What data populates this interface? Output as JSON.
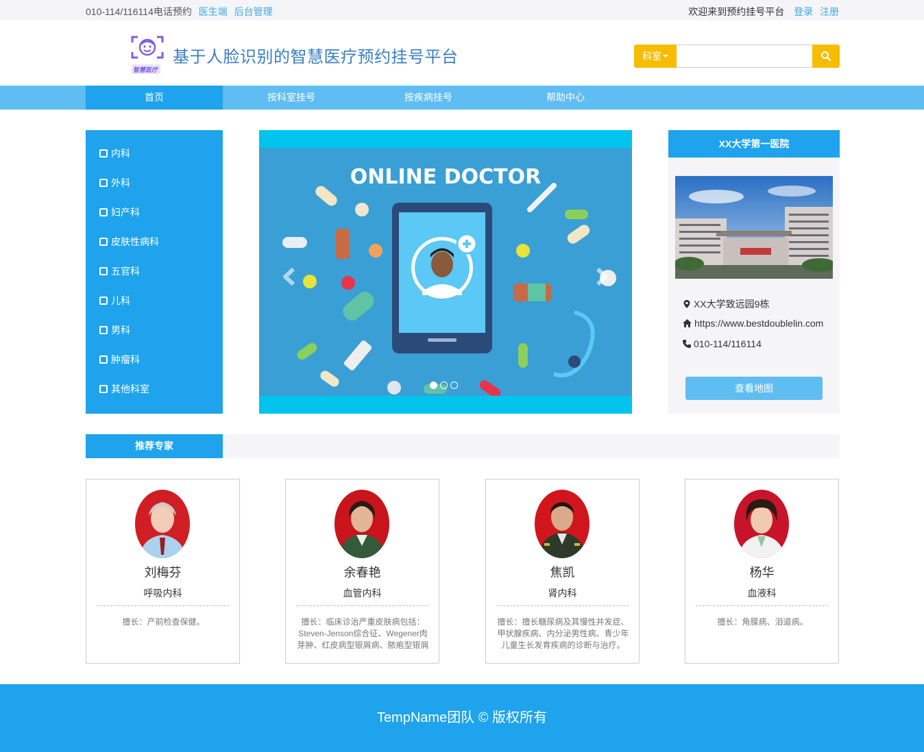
{
  "topbar": {
    "phone_text": "010-114/116114电话预约",
    "doctor_link": "医生端",
    "admin_link": "后台管理",
    "welcome": "欢迎来到预约挂号平台",
    "login": "登录",
    "register": "注册"
  },
  "header": {
    "logo_text": "智慧医疗",
    "title": "基于人脸识别的智慧医疗预约挂号平台",
    "search": {
      "dept_label": "科室",
      "placeholder": "",
      "button_icon": "search-icon"
    }
  },
  "nav": {
    "items": [
      {
        "label": "首页",
        "active": true
      },
      {
        "label": "按科室挂号"
      },
      {
        "label": "按疾病挂号"
      },
      {
        "label": "帮助中心"
      }
    ]
  },
  "sidebar": {
    "items": [
      "内科",
      "外科",
      "妇产科",
      "皮肤性病科",
      "五官科",
      "儿科",
      "男科",
      "肿瘤科",
      "其他科室"
    ]
  },
  "carousel": {
    "headline": "ONLINE DOCTOR",
    "slide_count": 3,
    "active_index": 0
  },
  "hospital": {
    "name": "XX大学第一医院",
    "address": "XX大学致远园9栋",
    "website": "https://www.bestdoublelin.com",
    "phone": "010-114/116114",
    "map_button": "查看地图"
  },
  "experts": {
    "tab": "推荐专家",
    "cards": [
      {
        "name": "刘梅芬",
        "dept": "呼吸内科",
        "desc": "擅长：产前检查保健。"
      },
      {
        "name": "余春艳",
        "dept": "血管内科",
        "desc": "擅长：临床诊治严重皮肤病包括：Steven-Jenson综合征、Wegener肉芽肿、红皮病型银屑病、脓疱型银屑病"
      },
      {
        "name": "焦凯",
        "dept": "肾内科",
        "desc": "擅长：擅长糖尿病及其慢性并发症、甲状腺疾病、内分泌男性病、青少年儿童生长发育疾病的诊断与治疗。"
      },
      {
        "name": "杨华",
        "dept": "血液科",
        "desc": "擅长：角膜病、泪道病。"
      }
    ]
  },
  "footer": {
    "text": "TempName团队 © 版权所有"
  },
  "colors": {
    "primary": "#1ea3ec",
    "nav": "#5fbdf2",
    "accent": "#f8bc00",
    "title": "#3a7ec2"
  }
}
